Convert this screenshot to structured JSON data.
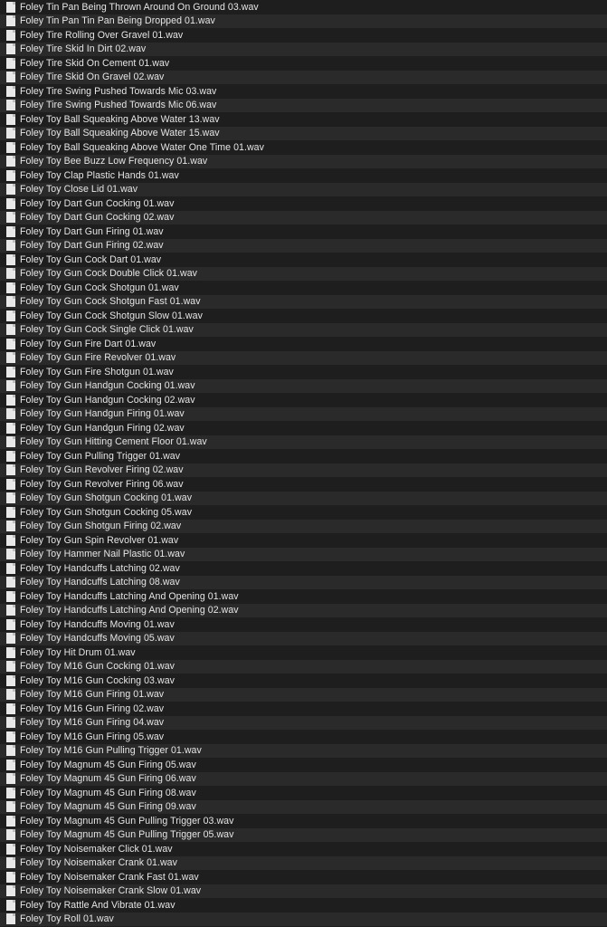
{
  "file_icon": "audio-file-icon",
  "files": [
    "Foley Tin Pan Being Thrown Around On Ground 03.wav",
    "Foley Tin Pan Tin Pan Being Dropped 01.wav",
    "Foley Tire Rolling Over Gravel 01.wav",
    "Foley Tire Skid In Dirt 02.wav",
    "Foley Tire Skid On Cement 01.wav",
    "Foley Tire Skid On Gravel 02.wav",
    "Foley Tire Swing Pushed Towards Mic 03.wav",
    "Foley Tire Swing Pushed Towards Mic 06.wav",
    "Foley Toy Ball Squeaking Above Water 13.wav",
    "Foley Toy Ball Squeaking Above Water 15.wav",
    "Foley Toy Ball Squeaking Above Water One Time 01.wav",
    "Foley Toy Bee Buzz Low Frequency 01.wav",
    "Foley Toy Clap Plastic Hands 01.wav",
    "Foley Toy Close Lid 01.wav",
    "Foley Toy Dart Gun Cocking 01.wav",
    "Foley Toy Dart Gun Cocking 02.wav",
    "Foley Toy Dart Gun Firing 01.wav",
    "Foley Toy Dart Gun Firing 02.wav",
    "Foley Toy Gun Cock Dart 01.wav",
    "Foley Toy Gun Cock Double Click 01.wav",
    "Foley Toy Gun Cock Shotgun 01.wav",
    "Foley Toy Gun Cock Shotgun Fast 01.wav",
    "Foley Toy Gun Cock Shotgun Slow 01.wav",
    "Foley Toy Gun Cock Single Click 01.wav",
    "Foley Toy Gun Fire Dart 01.wav",
    "Foley Toy Gun Fire Revolver 01.wav",
    "Foley Toy Gun Fire Shotgun 01.wav",
    "Foley Toy Gun Handgun Cocking 01.wav",
    "Foley Toy Gun Handgun Cocking 02.wav",
    "Foley Toy Gun Handgun Firing 01.wav",
    "Foley Toy Gun Handgun Firing 02.wav",
    "Foley Toy Gun Hitting Cement Floor 01.wav",
    "Foley Toy Gun Pulling Trigger 01.wav",
    "Foley Toy Gun Revolver Firing 02.wav",
    "Foley Toy Gun Revolver Firing 06.wav",
    "Foley Toy Gun Shotgun Cocking 01.wav",
    "Foley Toy Gun Shotgun Cocking 05.wav",
    "Foley Toy Gun Shotgun Firing 02.wav",
    "Foley Toy Gun Spin Revolver 01.wav",
    "Foley Toy Hammer Nail Plastic 01.wav",
    "Foley Toy Handcuffs Latching 02.wav",
    "Foley Toy Handcuffs Latching 08.wav",
    "Foley Toy Handcuffs Latching And Opening 01.wav",
    "Foley Toy Handcuffs Latching And Opening 02.wav",
    "Foley Toy Handcuffs Moving 01.wav",
    "Foley Toy Handcuffs Moving 05.wav",
    "Foley Toy Hit Drum 01.wav",
    "Foley Toy M16 Gun Cocking 01.wav",
    "Foley Toy M16 Gun Cocking 03.wav",
    "Foley Toy M16 Gun Firing 01.wav",
    "Foley Toy M16 Gun Firing 02.wav",
    "Foley Toy M16 Gun Firing 04.wav",
    "Foley Toy M16 Gun Firing 05.wav",
    "Foley Toy M16 Gun Pulling Trigger 01.wav",
    "Foley Toy Magnum 45 Gun Firing 05.wav",
    "Foley Toy Magnum 45 Gun Firing 06.wav",
    "Foley Toy Magnum 45 Gun Firing 08.wav",
    "Foley Toy Magnum 45 Gun Firing 09.wav",
    "Foley Toy Magnum 45 Gun Pulling Trigger 03.wav",
    "Foley Toy Magnum 45 Gun Pulling Trigger 05.wav",
    "Foley Toy Noisemaker Click 01.wav",
    "Foley Toy Noisemaker Crank 01.wav",
    "Foley Toy Noisemaker Crank Fast 01.wav",
    "Foley Toy Noisemaker Crank Slow 01.wav",
    "Foley Toy Rattle And Vibrate 01.wav",
    "Foley Toy Roll 01.wav"
  ]
}
